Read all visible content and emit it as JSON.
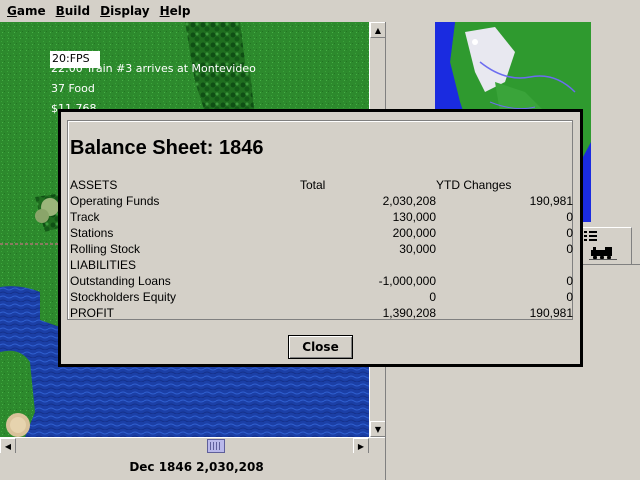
{
  "menu": {
    "items": [
      {
        "id": "game",
        "label": "Game",
        "mnemonic": "G"
      },
      {
        "id": "build",
        "label": "Build",
        "mnemonic": "B"
      },
      {
        "id": "display",
        "label": "Display",
        "mnemonic": "D"
      },
      {
        "id": "help",
        "label": "Help",
        "mnemonic": "H"
      }
    ]
  },
  "map": {
    "fps": "20:FPS",
    "message": "22:00 Train #3 arrives at Montevideo",
    "food": "37 Food",
    "money": "$11,768",
    "colors": {
      "grass": "#2d8a2d",
      "water": "#1b3fa6",
      "forest": "#0f4f14",
      "rail": "#8a7a60"
    }
  },
  "status": {
    "date": "Dec 1846",
    "cash": "2,030,208"
  },
  "dialog": {
    "title": "Balance Sheet: 1846",
    "columns": {
      "label": "ASSETS",
      "total": "Total",
      "ytd": "YTD Changes"
    },
    "rows": [
      {
        "label": "Operating Funds",
        "total": "2,030,208",
        "ytd": "190,981"
      },
      {
        "label": "Track",
        "total": "130,000",
        "ytd": "0"
      },
      {
        "label": "Stations",
        "total": "200,000",
        "ytd": "0"
      },
      {
        "label": "Rolling Stock",
        "total": "30,000",
        "ytd": "0"
      },
      {
        "label": "LIABILITIES",
        "total": "",
        "ytd": ""
      },
      {
        "label": "Outstanding Loans",
        "total": "-1,000,000",
        "ytd": "0"
      },
      {
        "label": "Stockholders Equity",
        "total": "0",
        "ytd": "0"
      },
      {
        "label": "PROFIT",
        "total": "1,390,208",
        "ytd": "190,981"
      }
    ],
    "close_label": "Close"
  },
  "icons": {
    "up_arrow": "▲",
    "down_arrow": "▼",
    "left_arrow": "◀",
    "right_arrow": "▶",
    "train_list": "train-list-icon",
    "train": "train-icon"
  }
}
